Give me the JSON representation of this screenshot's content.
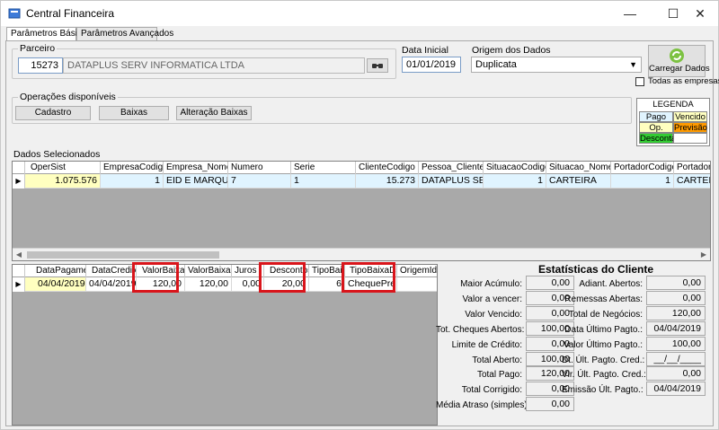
{
  "window": {
    "title": "Central Financeira",
    "controls": {
      "minimize": "—",
      "maximize": "☐",
      "close": "✕"
    }
  },
  "tabs": [
    {
      "label": "Parâmetros Básicos"
    },
    {
      "label": "Parâmetros Avançados"
    }
  ],
  "filters": {
    "parceiro_label": "Parceiro",
    "parceiro_code": "15273",
    "parceiro_name": "DATAPLUS SERV INFORMATICA LTDA",
    "data_inicial_label": "Data Inicial",
    "data_inicial_value": "01/01/2019",
    "origem_label": "Origem dos Dados",
    "origem_value": "Duplicata",
    "carregar_label": "Carregar Dados",
    "todas_empresas_label": "Todas as empresas"
  },
  "operacoes": {
    "title": "Operações disponíveis",
    "buttons": [
      "Cadastro",
      "Baixas",
      "Alteração Baixas"
    ]
  },
  "legenda": {
    "title": "LEGENDA",
    "items": [
      {
        "label": "Pago",
        "color": "#e0f4ff"
      },
      {
        "label": "Vencido",
        "color": "#ffffc0"
      },
      {
        "label": "Op.",
        "color": "#ffffc0"
      },
      {
        "label": "Previsão",
        "color": "#ff9a00"
      },
      {
        "label": "Desconta",
        "color": "#33cc33"
      },
      {
        "label": "",
        "color": "#ffffff"
      }
    ]
  },
  "dados_selecionados": {
    "title": "Dados Selecionados",
    "columns": [
      "OperSist",
      "EmpresaCodigo",
      "Empresa_Nome",
      "Numero",
      "Serie",
      "ClienteCodigo",
      "Pessoa_Cliente_No",
      "SituacaoCodigo",
      "Situacao_Nome",
      "PortadorCodigo",
      "Portador_No"
    ],
    "row": [
      "1.075.576",
      "1",
      "EID E MARQUE...",
      "7",
      "1",
      "15.273",
      "DATAPLUS SER...",
      "1",
      "CARTEIRA",
      "1",
      "CARTEIRA"
    ]
  },
  "baixas": {
    "columns": [
      "DataPagamento",
      "DataCredito",
      "ValorBaixa",
      "ValorBaixaOrig",
      "Juros",
      "Descontos",
      "TipoBaixa",
      "TipoBaixaDsc",
      "OrigemId"
    ],
    "row": [
      "04/04/2019",
      "04/04/2019",
      "120,00",
      "120,00",
      "0,00",
      "20,00",
      "6",
      "ChequePre",
      ""
    ]
  },
  "estatisticas": {
    "title": "Estatísticas do Cliente",
    "left": [
      {
        "label": "Maior Acúmulo:",
        "value": "0,00"
      },
      {
        "label": "Valor a vencer:",
        "value": "0,00"
      },
      {
        "label": "Valor Vencido:",
        "value": "0,00"
      },
      {
        "label": "Tot. Cheques Abertos:",
        "value": "100,00"
      },
      {
        "label": "Limite de Crédito:",
        "value": "0,00"
      },
      {
        "label": "Total Aberto:",
        "value": "100,00"
      },
      {
        "label": "Total Pago:",
        "value": "120,00"
      },
      {
        "label": "Total Corrigido:",
        "value": "0,00"
      },
      {
        "label": "Média Atraso (simples):",
        "value": "0,00"
      }
    ],
    "right": [
      {
        "label": "Adiant. Abertos:",
        "value": "0,00"
      },
      {
        "label": "Remessas Abertas:",
        "value": "0,00"
      },
      {
        "label": "Total de Negócios:",
        "value": "120,00"
      },
      {
        "label": "Data Último Pagto.:",
        "value": "04/04/2019"
      },
      {
        "label": "Valor Último Pagto.:",
        "value": "100,00"
      },
      {
        "label": "Dt. Últ. Pagto. Cred.:",
        "value": "__/__/____"
      },
      {
        "label": "Vlr. Últ. Pagto. Cred.:",
        "value": "0,00"
      },
      {
        "label": "Emissão Últ. Pagto.:",
        "value": "04/04/2019"
      }
    ]
  },
  "colors": {
    "highlight": "#d9151b",
    "selected_cell": "#ffffc0",
    "paid_cell": "#e0f4ff"
  }
}
